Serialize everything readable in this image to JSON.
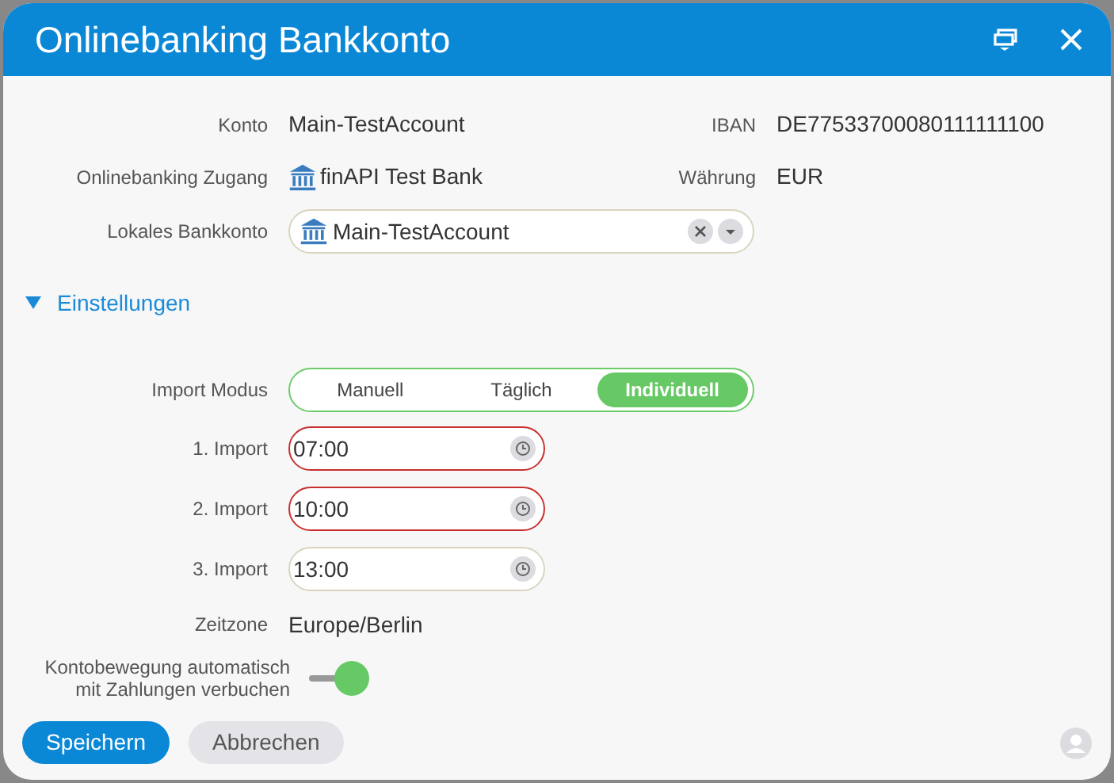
{
  "window": {
    "title": "Onlinebanking Bankkonto"
  },
  "info": [
    {
      "label": "Konto",
      "value": "Main-TestAccount",
      "right_label": "IBAN",
      "right_value": "DE77533700080111111100"
    },
    {
      "label": "Onlinebanking Zugang",
      "value": "finAPI Test Bank",
      "bank_icon": true,
      "right_label": "Währung",
      "right_value": "EUR"
    }
  ],
  "local_account": {
    "label": "Lokales Bankkonto",
    "value": "Main-TestAccount"
  },
  "section": {
    "title": "Einstellungen",
    "expanded": true
  },
  "import_mode": {
    "label": "Import Modus",
    "options": [
      {
        "label": "Manuell",
        "selected": false
      },
      {
        "label": "Täglich",
        "selected": false
      },
      {
        "label": "Individuell",
        "selected": true
      }
    ]
  },
  "imports": [
    {
      "label": "1. Import",
      "value": "07:00",
      "invalid": true
    },
    {
      "label": "2. Import",
      "value": "10:00",
      "invalid": true
    },
    {
      "label": "3. Import",
      "value": "13:00",
      "invalid": false
    }
  ],
  "timezone": {
    "label": "Zeitzone",
    "value": "Europe/Berlin"
  },
  "auto_book": {
    "label_lines": [
      "Kontobewegung automatisch",
      "mit Zahlungen verbuchen"
    ],
    "on": true
  },
  "buttons": [
    {
      "label": "Speichern",
      "kind": "primary"
    },
    {
      "label": "Abbrechen",
      "kind": "secondary"
    }
  ]
}
